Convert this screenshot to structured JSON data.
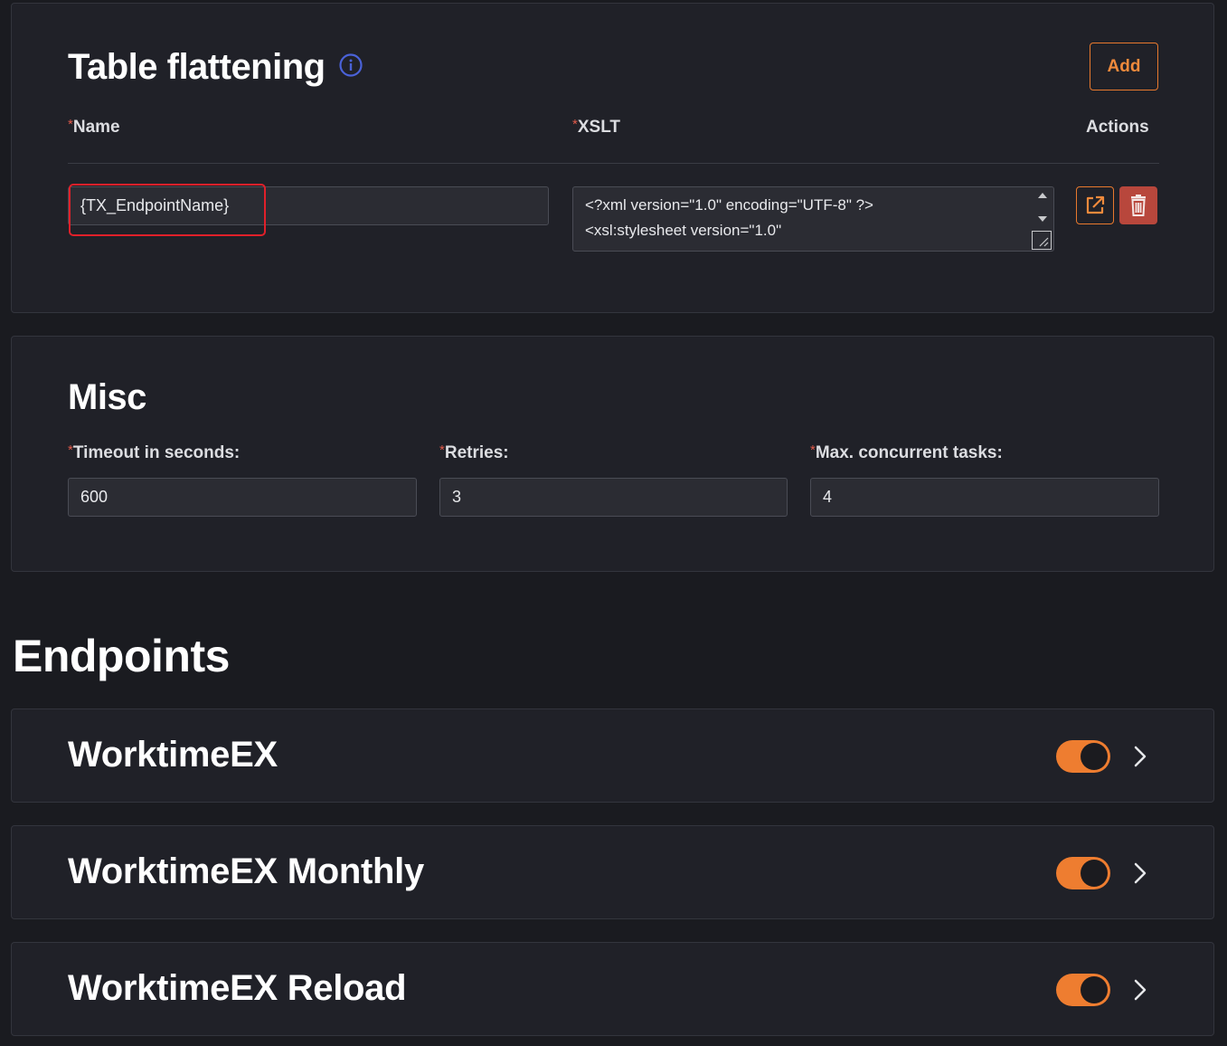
{
  "table_flattening": {
    "title": "Table flattening",
    "add_label": "Add",
    "columns": {
      "name": "Name",
      "xslt": "XSLT",
      "actions": "Actions"
    },
    "required_mark": "*",
    "row": {
      "name_value": "{TX_EndpointName}",
      "xslt_value": "<?xml version=\"1.0\" encoding=\"UTF-8\" ?>\n<xsl:stylesheet version=\"1.0\""
    }
  },
  "misc": {
    "title": "Misc",
    "timeout_label": "Timeout in seconds:",
    "timeout_value": "600",
    "retries_label": "Retries:",
    "retries_value": "3",
    "max_tasks_label": "Max. concurrent tasks:",
    "max_tasks_value": "4"
  },
  "endpoints": {
    "title": "Endpoints",
    "items": [
      {
        "name": "WorktimeEX",
        "enabled": true
      },
      {
        "name": "WorktimeEX Monthly",
        "enabled": true
      },
      {
        "name": "WorktimeEX Reload",
        "enabled": true
      }
    ]
  },
  "colors": {
    "accent": "#ee7d30",
    "danger": "#b8473c",
    "info": "#4a62d8",
    "highlight": "#e0202a"
  }
}
